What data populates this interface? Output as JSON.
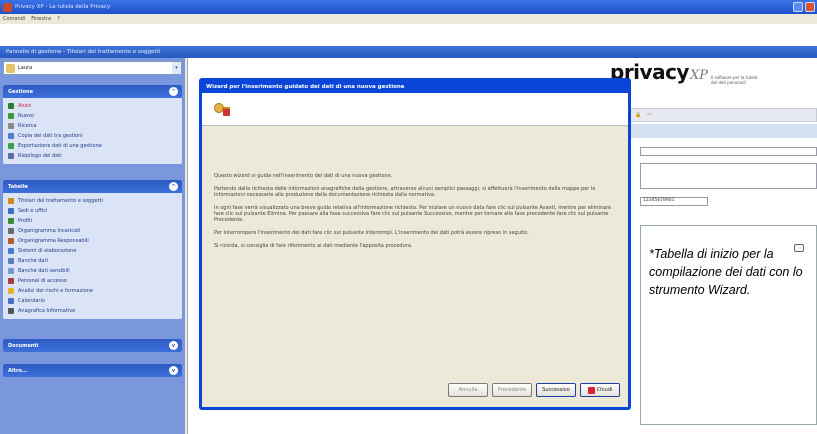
{
  "window": {
    "title": "Privacy XP - La tutela della Privacy"
  },
  "menubar": {
    "items": [
      "Comandi",
      "Finestra",
      "?"
    ]
  },
  "panel": {
    "title": "Pannello di gestione - Titolari del trattamento e soggetti"
  },
  "sidebar": {
    "selected_user": "Laura",
    "groups": [
      {
        "title": "Gestione",
        "items": [
          "Aiuto",
          "Nuovo",
          "Ricerca",
          "Copia dei dati tra gestioni",
          "Esportazione dati di una gestione",
          "Riepilogo dei dati"
        ]
      },
      {
        "title": "Tabelle",
        "items": [
          "Titolari del trattamento e soggetti",
          "Sedi e uffici",
          "Profili",
          "Organigramma Incaricati",
          "Organigramma Responsabili",
          "Sistemi di elaborazione",
          "Banche dati",
          "Banche dati sensibili",
          "Personal di accesso",
          "Analisi dei rischi e formazione",
          "Calendario",
          "Anagrafica Informative"
        ]
      },
      {
        "title": "Documenti",
        "items": []
      },
      {
        "title": "Altro...",
        "items": []
      }
    ]
  },
  "logo": {
    "brand": "privacy",
    "suffix": "XP",
    "tagline": "Il software per la tutela dei dati personali"
  },
  "right_panel": {
    "code": "12345678901"
  },
  "dialog": {
    "title": "Wizard per l'inserimento guidato dei dati di una nuova gestione",
    "paragraphs": [
      "Questo wizard vi guida nell'inserimento dei dati di una nuova gestione.",
      "Partendo dalla richiesta delle informazioni anagrafiche della gestione, attraverso alcuni semplici passaggi, si effettuerà l'inserimento delle mappe per le informazioni necessarie alla produzione della documentazione richiesta dalla normativa.",
      "In ogni fase verrà visualizzato una breve guida relativa all'informazione richiesta. Per iniziare un nuovo data fare clic sul pulsante Avanti, mentre per eliminare fare clic sul pulsante Elimina. Per passare alla fase successiva fare clic sul pulsante Successivo, mentre per tornare alla fase precedente fare clic sul pulsante Precedente.",
      "Per interrompere l'inserimento dei dati fare clic sul pulsante Interrompi. L'inserimento dei dati potrà essere ripreso in seguito.",
      "Si ricorda, si consiglia di fare riferimento ai dati mediante l'apposita procedura."
    ],
    "buttons": {
      "cancel": "Annulla",
      "previous": "Precedente",
      "next": "Successivo",
      "close": "Chiudi"
    }
  },
  "callout": {
    "text": "*Tabella di inizio per la compilazione dei dati con lo strumento Wizard."
  }
}
